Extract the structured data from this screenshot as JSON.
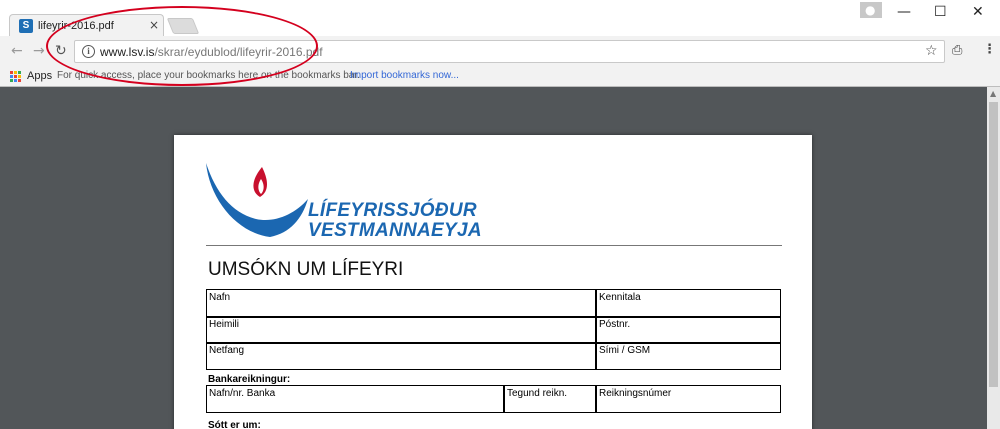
{
  "browser": {
    "tab_title": "lifeyrir-2016.pdf",
    "tab_close": "×",
    "favicon_letter": "S",
    "window": {
      "minimize": "—",
      "maximize": "☐",
      "close": "✕"
    },
    "nav": {
      "back": "←",
      "forward": "→",
      "reload": "↻"
    },
    "address": {
      "info": "i",
      "host": "www.lsv.is",
      "path": "/skrar/eydublod/lifeyrir-2016.pdf"
    },
    "star": "☆",
    "extension_glyph": "⎙",
    "menu_glyph": "⋮",
    "profile_glyph": "●"
  },
  "bookmarks_bar": {
    "apps_label": "Apps",
    "hint": "For quick access, place your bookmarks here on the bookmarks bar.",
    "import_link": "Import bookmarks now..."
  },
  "document": {
    "org_line1": "LÍFEYRISSJÓÐUR",
    "org_line2": "VESTMANNAEYJA",
    "form_title": "UMSÓKN UM LÍFEYRI",
    "fields": {
      "nafn": "Nafn",
      "kennitala": "Kennitala",
      "heimili": "Heimili",
      "postnr": "Póstnr.",
      "netfang": "Netfang",
      "simi": "Sími / GSM"
    },
    "bank_section": "Bankareikningur:",
    "bank_fields": {
      "bank_name": "Nafn/nr. Banka",
      "account_type": "Tegund reikn.",
      "account_number": "Reikningsnúmer"
    },
    "applied_section": "Sótt er um:"
  },
  "colors": {
    "brand_blue": "#1b67b1",
    "flame_red": "#c8102e",
    "annotation_red": "#d4001e"
  }
}
